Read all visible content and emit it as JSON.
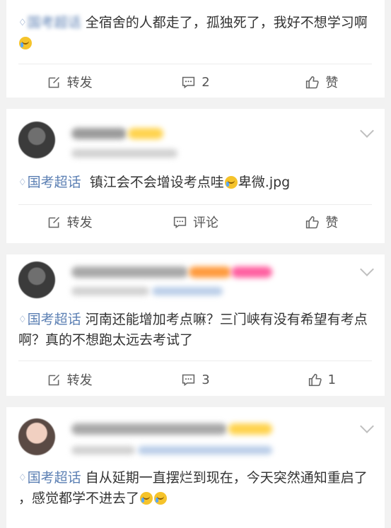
{
  "posts": [
    {
      "topic": "",
      "text": "全宿舍的人都走了，孤独死了，我好不想学习啊",
      "actions": {
        "repost": "转发",
        "comment": "2",
        "like": "赞"
      }
    },
    {
      "topic": "国考超话",
      "text_before": "镇江会不会增设考点哇",
      "text_after": "卑微.jpg",
      "actions": {
        "repost": "转发",
        "comment": "评论",
        "like": "赞"
      }
    },
    {
      "topic": "国考超话",
      "text": "河南还能增加考点嘛？三门峡有没有希望有考点啊？真的不想跑太远去考试了",
      "actions": {
        "repost": "转发",
        "comment": "3",
        "like": "1"
      }
    },
    {
      "topic": "国考超话",
      "text_before": "自从延期一直摆烂到现在，今天突然通知重启了 ，感觉都学不进去了",
      "actions": {}
    }
  ],
  "icons": {
    "repost": "edit-share-icon",
    "comment": "comment-icon",
    "like": "thumbs-up-icon",
    "collapse": "chevron-down-icon",
    "topic": "diamond-topic-icon"
  },
  "colors": {
    "topic": "#5b7fb3",
    "background": "#f2f2f2",
    "card": "#ffffff",
    "text": "#333333"
  }
}
